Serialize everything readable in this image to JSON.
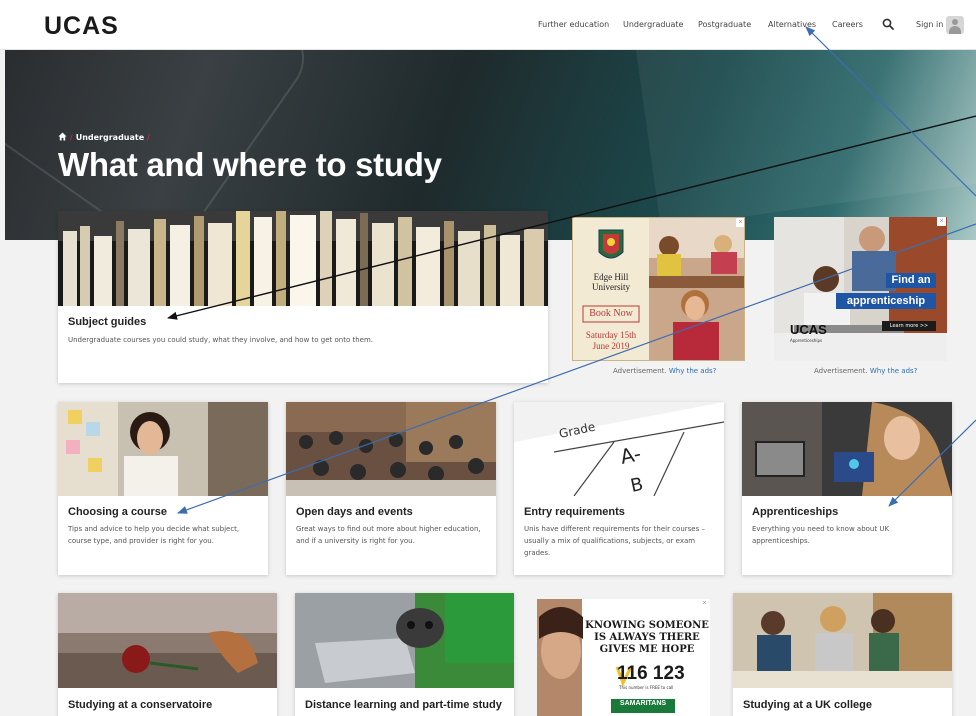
{
  "header": {
    "logo": "UCAS",
    "nav": [
      "Further education",
      "Undergraduate",
      "Postgraduate",
      "Alternatives",
      "Careers"
    ],
    "signin": "Sign in"
  },
  "hero": {
    "breadcrumb": "Undergraduate",
    "title": "What and where to study"
  },
  "featured": {
    "title": "Subject guides",
    "desc": "Undergraduate courses you could study, what they involve, and how to get onto them."
  },
  "ads": {
    "caption": "Advertisement.",
    "why": "Why the ads?",
    "edgehill": {
      "name1": "Edge Hill",
      "name2": "University",
      "button": "Book Now",
      "date1": "Saturday 15th",
      "date2": "June 2019"
    },
    "apprentice": {
      "line1": "Find an",
      "line2": "apprenticeship",
      "brand": "UCAS",
      "sub": "Apprenticeships",
      "button": "Learn more >>"
    },
    "samaritans": {
      "line1": "KNOWING SOMEONE",
      "line2": "IS ALWAYS THERE",
      "line3": "GIVES ME HOPE",
      "number": "116 123",
      "note": "This number is FREE to call",
      "brand": "SAMARITANS"
    }
  },
  "cards": [
    {
      "title": "Choosing a course",
      "desc1": "Tips and advice to help you decide what subject,",
      "desc2": "course type, and provider is right for you.",
      "desc3": ""
    },
    {
      "title": "Open days and events",
      "desc1": "Great ways to find out more about higher education,",
      "desc2": "and if a university is right for you.",
      "desc3": ""
    },
    {
      "title": "Entry requirements",
      "desc1": "Unis have different requirements for their courses –",
      "desc2": "usually a mix of qualifications, subjects, or exam",
      "desc3": "grades."
    },
    {
      "title": "Apprenticeships",
      "desc1": "Everything you need to know about UK",
      "desc2": "apprenticeships.",
      "desc3": ""
    }
  ],
  "bottom_cards": [
    {
      "title": "Studying at a conservatoire"
    },
    {
      "title": "Distance learning and part-time study"
    },
    {
      "title": "Studying at a UK college"
    }
  ],
  "entry_image": {
    "label1": "Grade",
    "label2": "A-",
    "label3": "B"
  },
  "colors": {
    "accent": "#e2264a",
    "link": "#2a6ebb",
    "arrow_blue": "#3c6db0"
  }
}
